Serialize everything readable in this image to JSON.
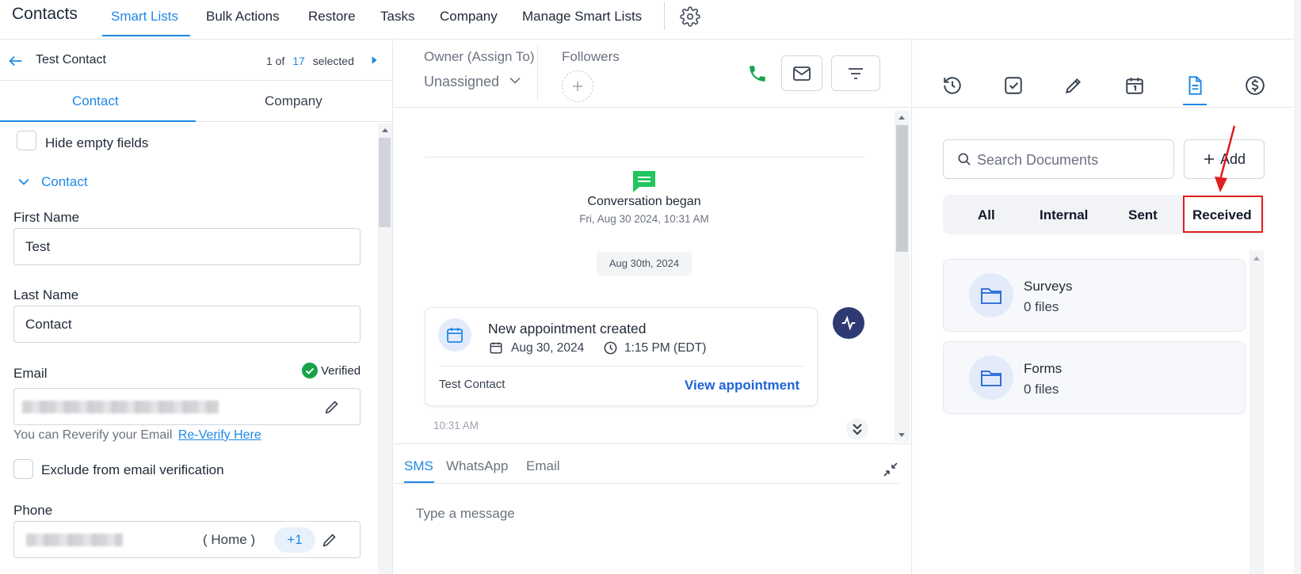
{
  "topnav": {
    "title": "Contacts",
    "tabs": [
      {
        "label": "Smart Lists",
        "active": true
      },
      {
        "label": "Bulk Actions"
      },
      {
        "label": "Restore"
      },
      {
        "label": "Tasks"
      },
      {
        "label": "Company"
      },
      {
        "label": "Manage Smart Lists"
      }
    ],
    "settings_icon": "gear-icon"
  },
  "contact_header": {
    "name": "Test Contact",
    "pager_prefix": "1 of",
    "pager_total": "17",
    "pager_suffix": "selected"
  },
  "left_tabs": [
    "Contact",
    "Company"
  ],
  "form": {
    "hide_empty_label": "Hide empty fields",
    "section_label": "Contact",
    "first_name_label": "First Name",
    "first_name_value": "Test",
    "last_name_label": "Last Name",
    "last_name_value": "Contact",
    "email_label": "Email",
    "verified_label": "Verified",
    "reverify_text": "You can Reverify your Email",
    "reverify_link": "Re-Verify Here",
    "exclude_label": "Exclude from email verification",
    "phone_label": "Phone",
    "phone_type": "( Home )",
    "phone_code": "+1"
  },
  "conversation": {
    "owner_label": "Owner (Assign To)",
    "owner_value": "Unassigned",
    "followers_label": "Followers",
    "began_title": "Conversation began",
    "began_time": "Fri, Aug 30 2024, 10:31 AM",
    "date_chip": "Aug 30th, 2024",
    "appointment": {
      "title": "New appointment created",
      "date": "Aug 30, 2024",
      "time": "1:15 PM (EDT)",
      "contact": "Test Contact",
      "link": "View appointment"
    },
    "msg_time": "10:31 AM",
    "composer_tabs": [
      "SMS",
      "WhatsApp",
      "Email"
    ],
    "composer_placeholder": "Type a message"
  },
  "documents": {
    "search_placeholder": "Search Documents",
    "add_label": "Add",
    "filters": [
      "All",
      "Internal",
      "Sent",
      "Received"
    ],
    "folders": [
      {
        "name": "Surveys",
        "count": "0 files"
      },
      {
        "name": "Forms",
        "count": "0 files"
      }
    ]
  },
  "colors": {
    "accent": "#1e88e5",
    "phone_green": "#16a34a",
    "message_green": "#22c55e",
    "annotation_red": "#e11d1d",
    "activity_navy": "#2f3a73"
  }
}
